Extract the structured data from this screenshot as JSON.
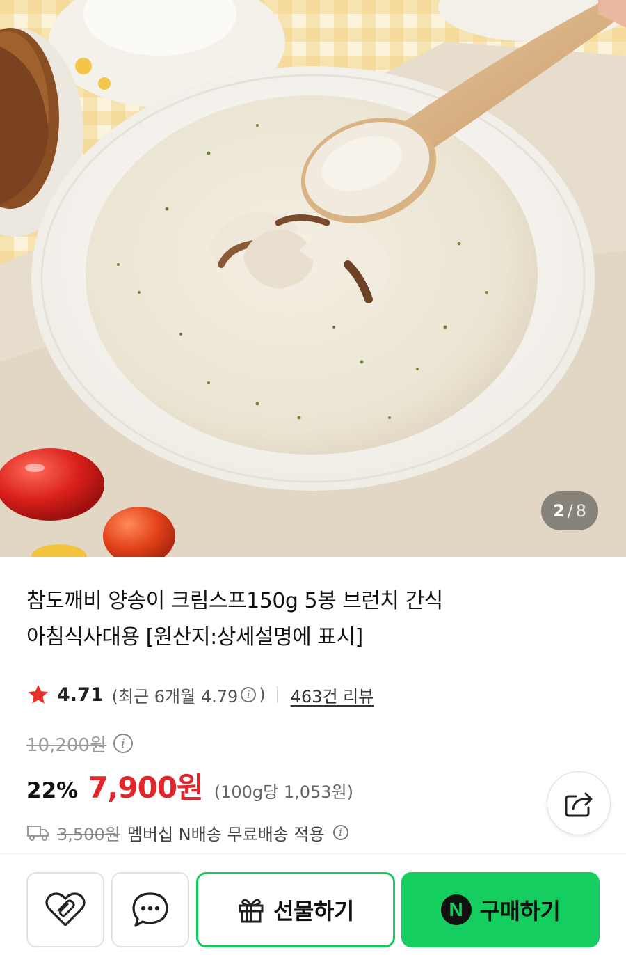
{
  "product": {
    "title_line1": "참도깨비 양송이 크림스프150g 5봉 브런치 간식",
    "title_line2": "아침식사대용 [원산지:상세설명에 표시]"
  },
  "gallery": {
    "current": "2",
    "separator": "/",
    "total": "8"
  },
  "rating": {
    "score": "4.71",
    "recent_prefix": "(최근 6개월 4.79",
    "recent_suffix": ")",
    "info_glyph": "i",
    "review_count": "463건 리뷰"
  },
  "price": {
    "original": "10,200원",
    "discount": "22%",
    "sale": "7,900원",
    "unit": "(100g당 1,053원)"
  },
  "shipping": {
    "fee": "3,500원",
    "text": "멤버십 N배송 무료배송 적용"
  },
  "actions": {
    "gift_label": "선물하기",
    "buy_label": "구매하기",
    "n_badge": "N"
  },
  "colors": {
    "sale_red": "#e0262b",
    "brand_green": "#14cf5f",
    "star": "#e8312b"
  },
  "icons": {
    "like": "heart-icon",
    "talk": "chat-bubble-icon",
    "gift": "gift-icon",
    "share": "share-icon",
    "shipping": "truck-icon"
  }
}
